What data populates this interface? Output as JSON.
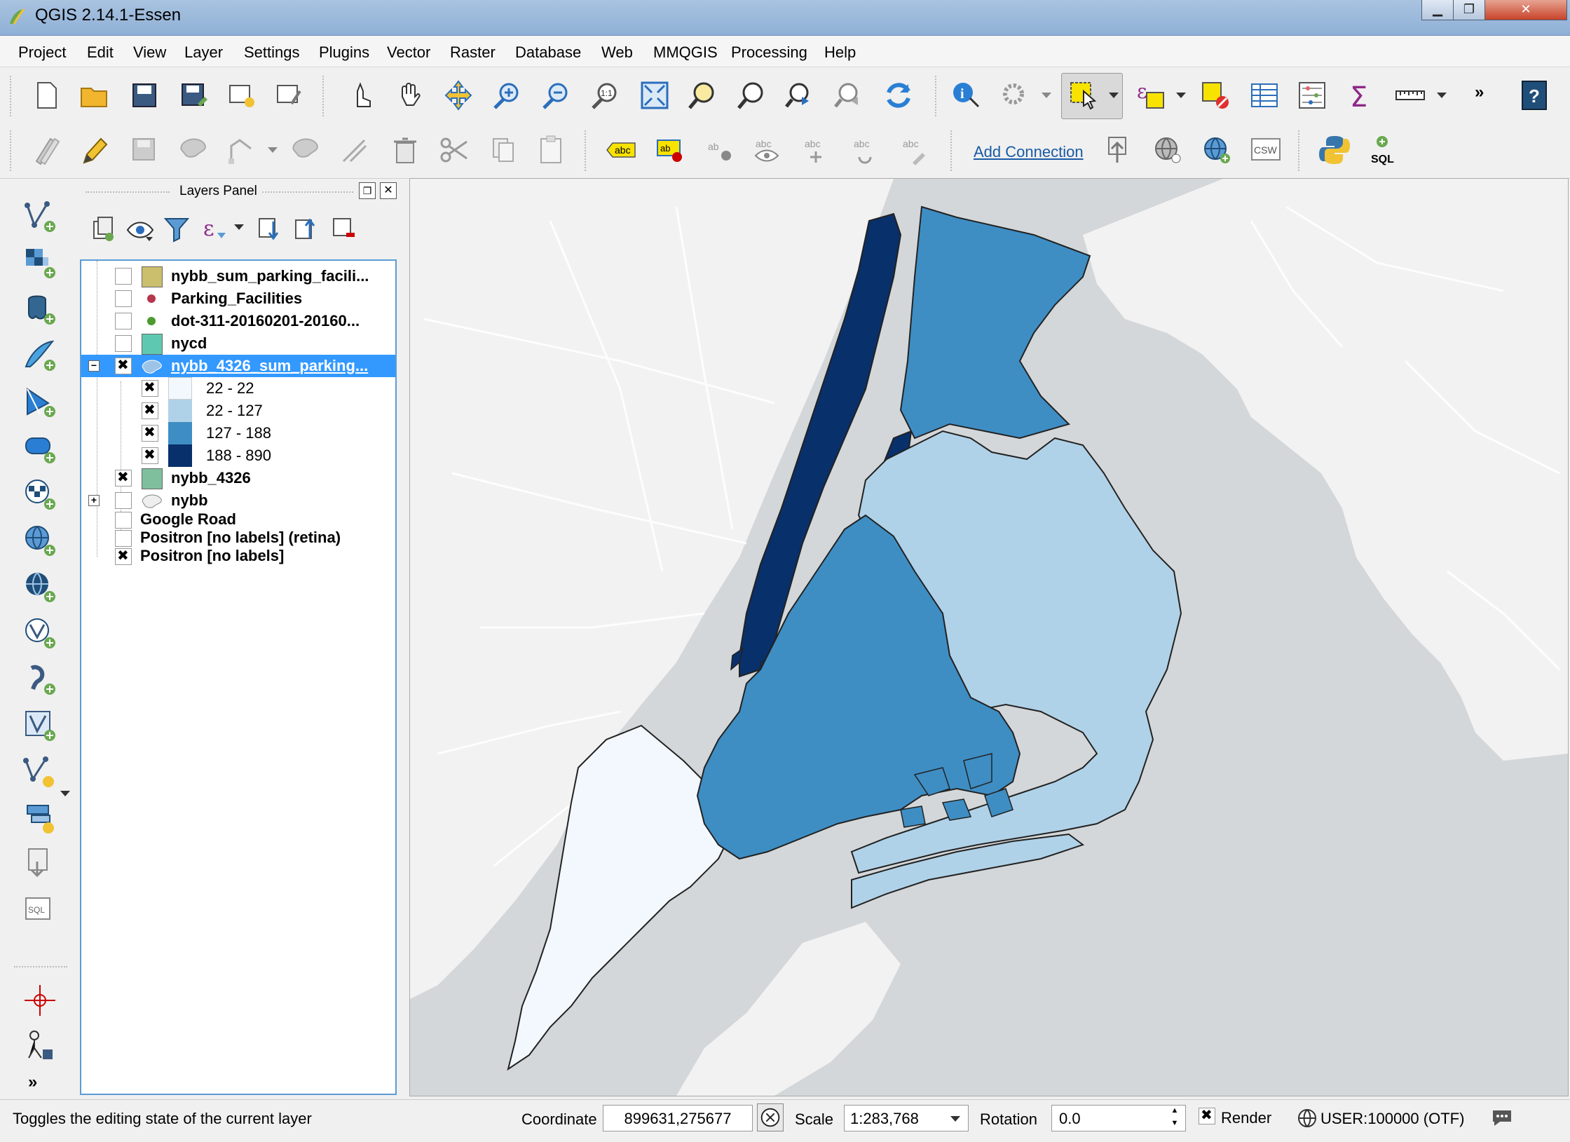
{
  "window": {
    "title": "QGIS 2.14.1-Essen"
  },
  "menubar": [
    "Project",
    "Edit",
    "View",
    "Layer",
    "Settings",
    "Plugins",
    "Vector",
    "Raster",
    "Database",
    "Web",
    "MMQGIS",
    "Processing",
    "Help"
  ],
  "toolbar2": {
    "add_connection": "Add Connection"
  },
  "layers_panel": {
    "title": "Layers Panel",
    "layers": [
      {
        "name": "nybb_sum_parking_facili...",
        "checked": false,
        "swatch": "#cbbf6d"
      },
      {
        "name": "Parking_Facilities",
        "checked": false,
        "swatch": "#b5364d"
      },
      {
        "name": "dot-311-20160201-20160...",
        "checked": false,
        "swatch": "#4d9a2f"
      },
      {
        "name": "nycd",
        "checked": false,
        "swatch": "#5ec9b0"
      },
      {
        "name": "nybb_4326_sum_parking...",
        "checked": true,
        "selected": true
      },
      {
        "name": "nybb_4326",
        "checked": true,
        "swatch": "#7fbf9e"
      },
      {
        "name": "nybb",
        "checked": false
      },
      {
        "name": "Google Road",
        "checked": false
      },
      {
        "name": "Positron [no labels] (retina)",
        "checked": false
      },
      {
        "name": "Positron [no labels]",
        "checked": true
      }
    ],
    "legend": [
      {
        "label": "22 - 22",
        "color": "#f3f8fe"
      },
      {
        "label": "22 - 127",
        "color": "#b0d2e8"
      },
      {
        "label": "127 - 188",
        "color": "#3e8ec4"
      },
      {
        "label": "188 - 890",
        "color": "#08306b"
      }
    ]
  },
  "statusbar": {
    "message": "Toggles the editing state of the current layer",
    "coordinate_label": "Coordinate",
    "coordinate_value": "899631,275677",
    "scale_label": "Scale",
    "scale_value": "1:283,768",
    "rotation_label": "Rotation",
    "rotation_value": "0.0",
    "render_label": "Render",
    "crs": "USER:100000 (OTF)"
  }
}
